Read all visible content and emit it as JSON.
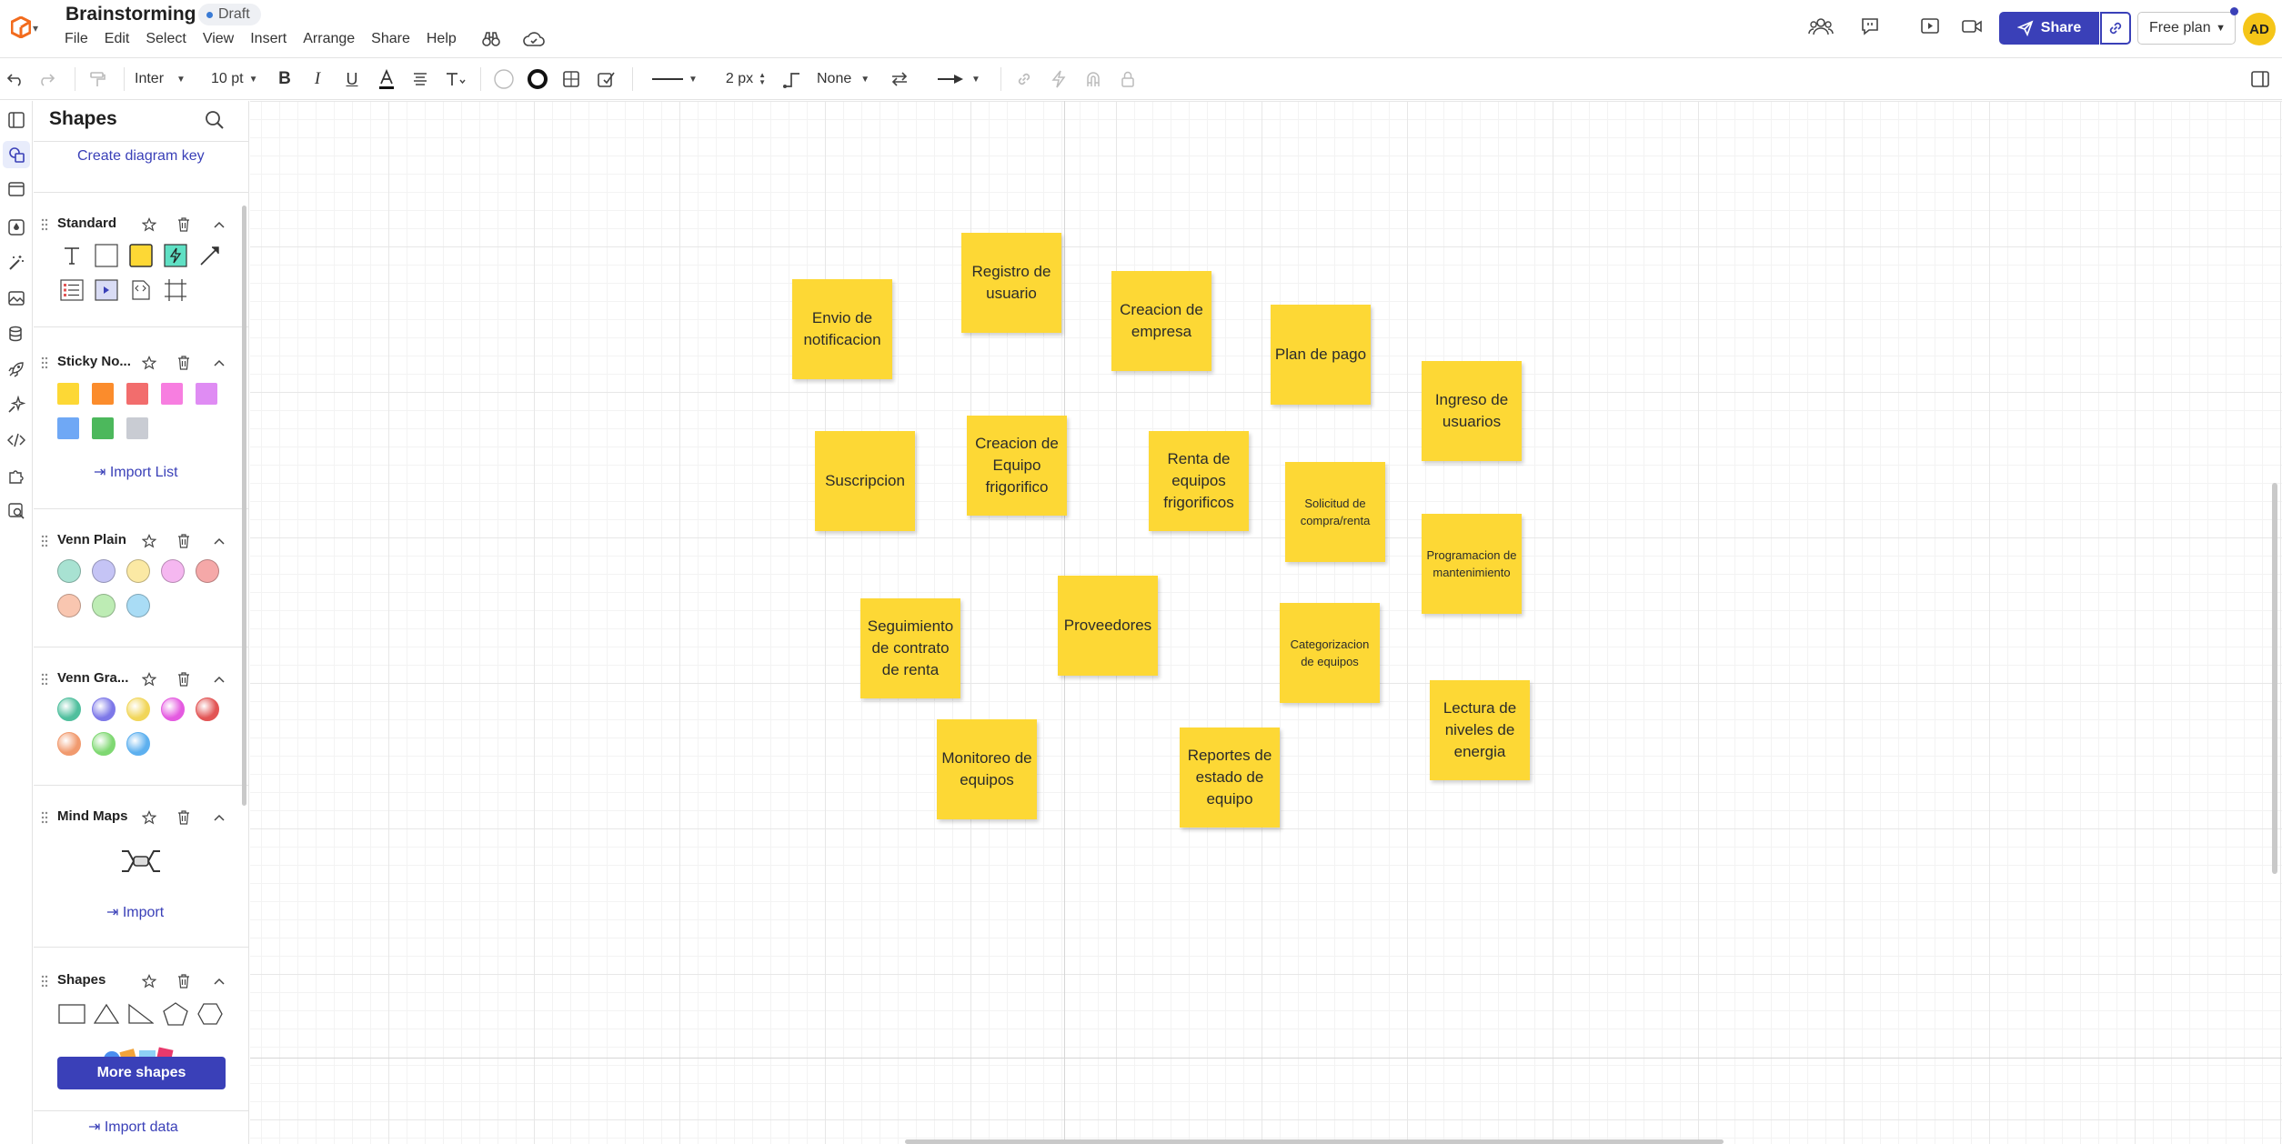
{
  "app": {
    "document_title": "Brainstorming",
    "status_badge": "Draft",
    "menu": [
      "File",
      "Edit",
      "Select",
      "View",
      "Insert",
      "Arrange",
      "Share",
      "Help"
    ],
    "share_label": "Share",
    "plan_label": "Free plan",
    "avatar_initials": "AD",
    "accent_color": "#3a40b8"
  },
  "toolbar": {
    "font_family": "Inter",
    "font_size": "10 pt",
    "line_width": "2 px",
    "endpoint_style": "None"
  },
  "shapes_panel": {
    "title": "Shapes",
    "create_key_label": "Create diagram key",
    "sections": {
      "standard": "Standard",
      "sticky": "Sticky No...",
      "venn_plain": "Venn Plain",
      "venn_gradient": "Venn Gra...",
      "mind_maps": "Mind Maps",
      "shapes": "Shapes"
    },
    "import_list_label": "Import List",
    "import_label": "Import",
    "more_shapes_label": "More shapes",
    "import_data_label": "Import data",
    "sticky_colors": [
      "#fdd835",
      "#fb8c2c",
      "#f26d6d",
      "#f77ee0",
      "#df8cf3",
      "#6fa8f5",
      "#4cb85c",
      "#c9ccd3"
    ],
    "venn_plain_colors": [
      "#a8e2d2",
      "#c5c4f5",
      "#fbe9a4",
      "#f5b7f0",
      "#f5a8a8",
      "#f9c6b0",
      "#bdecb4",
      "#a9dcf5"
    ],
    "venn_gradient_colors": [
      "#4fbf9d",
      "#7d78e8",
      "#f1d65a",
      "#e45ae0",
      "#e25555",
      "#f19a6e",
      "#7fd872",
      "#5db0ef"
    ]
  },
  "canvas": {
    "sticky_notes": [
      {
        "id": "envio",
        "text": "Envio de notificacion"
      },
      {
        "id": "registro",
        "text": "Registro de usuario"
      },
      {
        "id": "creacion-empresa",
        "text": "Creacion de empresa"
      },
      {
        "id": "plan-pago",
        "text": "Plan de pago"
      },
      {
        "id": "ingreso",
        "text": "Ingreso de usuarios"
      },
      {
        "id": "suscripcion",
        "text": "Suscripcion"
      },
      {
        "id": "creacion-equipo",
        "text": "Creacion de Equipo frigorifico"
      },
      {
        "id": "renta",
        "text": "Renta de equipos frigorificos"
      },
      {
        "id": "solicitud",
        "text": "Solicitud de compra/renta"
      },
      {
        "id": "programacion",
        "text": "Programacion de mantenimiento"
      },
      {
        "id": "seguimiento",
        "text": "Seguimiento de contrato de renta"
      },
      {
        "id": "proveedores",
        "text": "Proveedores"
      },
      {
        "id": "categorizacion",
        "text": "Categorizacion de equipos"
      },
      {
        "id": "lectura",
        "text": "Lectura de niveles de energia"
      },
      {
        "id": "monitoreo",
        "text": "Monitoreo de equipos"
      },
      {
        "id": "reportes",
        "text": "Reportes de estado de equipo"
      }
    ],
    "sticky_color": "#fdd835"
  }
}
